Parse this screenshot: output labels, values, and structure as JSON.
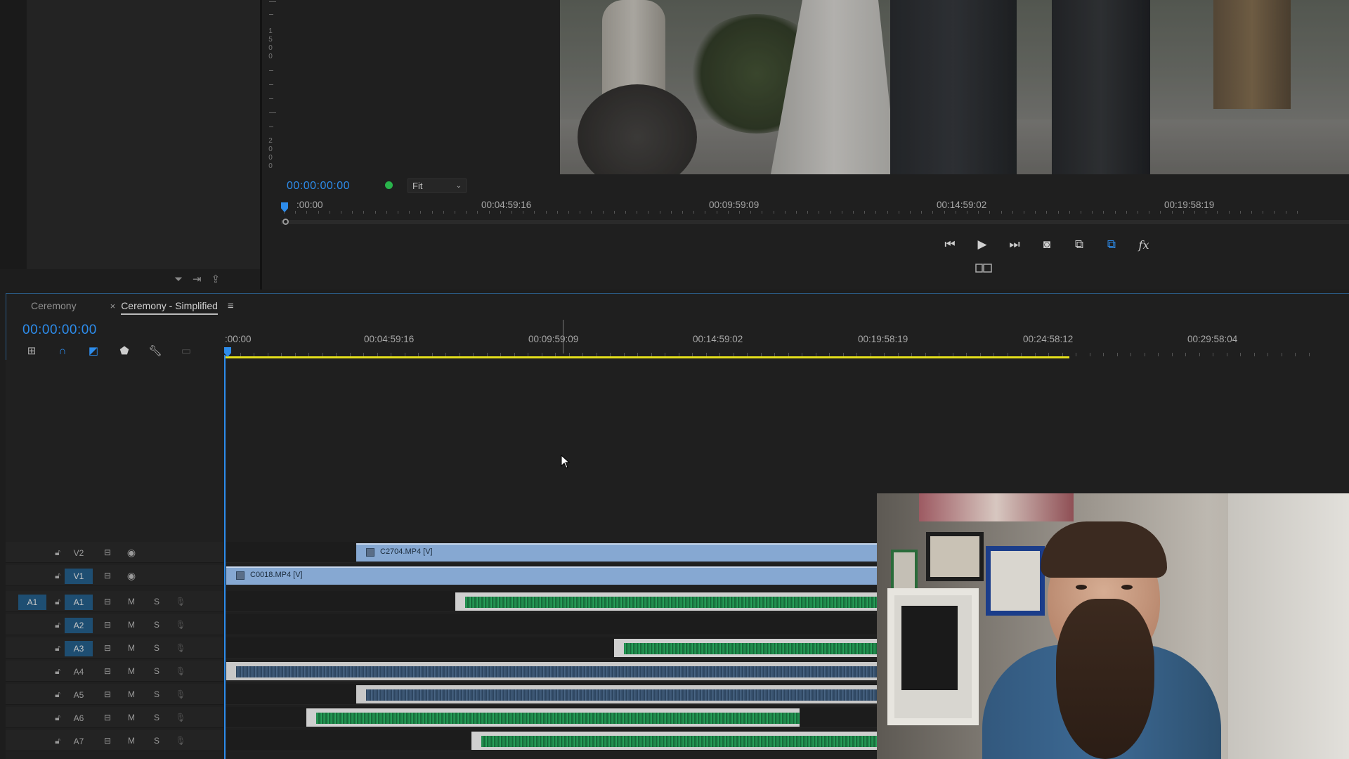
{
  "panel_tools": {
    "filter_icon": "filter-icon",
    "insert_icon": "insert-icon",
    "export_icon": "export-icon"
  },
  "monitor": {
    "timecode": "00:00:00:00",
    "fit_option": "Fit",
    "vruler_numbers": [
      "1",
      "5",
      "0",
      "0",
      "2",
      "0",
      "0",
      "0"
    ],
    "ruler_labels": [
      ":00:00",
      "00:04:59:16",
      "00:09:59:09",
      "00:14:59:02",
      "00:19:58:19"
    ],
    "transport": [
      "step-back-icon",
      "play-icon",
      "step-forward-icon",
      "export-frame-icon",
      "comparison-view-icon",
      "proxy-toggle-icon",
      "fx-icon"
    ],
    "fx_label": "fx"
  },
  "timeline": {
    "tabs": [
      {
        "label": "Ceremony"
      },
      {
        "label": "Ceremony - Simplified"
      }
    ],
    "close_glyph": "×",
    "menu_glyph": "≡",
    "timecode": "00:00:00:00",
    "ruler_labels": [
      ":00:00",
      "00:04:59:16",
      "00:09:59:09",
      "00:14:59:02",
      "00:19:58:19",
      "00:24:58:12",
      "00:29:58:04"
    ],
    "tools": [
      "nest-icon",
      "snap-icon",
      "linked-selection-icon",
      "marker-icon",
      "wrench-icon",
      "captions-icon"
    ],
    "source_patch": "A1",
    "video_tracks": [
      {
        "label": "V2",
        "clip_name": "C2704.MP4 [V]"
      },
      {
        "label": "V1",
        "clip_name": "C0018.MP4 [V]"
      }
    ],
    "audio_tracks": [
      {
        "label": "A1",
        "mute": "M",
        "solo": "S"
      },
      {
        "label": "A2",
        "mute": "M",
        "solo": "S"
      },
      {
        "label": "A3",
        "mute": "M",
        "solo": "S"
      },
      {
        "label": "A4",
        "mute": "M",
        "solo": "S"
      },
      {
        "label": "A5",
        "mute": "M",
        "solo": "S"
      },
      {
        "label": "A6",
        "mute": "M",
        "solo": "S"
      },
      {
        "label": "A7",
        "mute": "M",
        "solo": "S"
      }
    ]
  },
  "colors": {
    "accent": "#2d8ceb",
    "work_area": "#e5e01b",
    "video_clip": "#86a8d2",
    "audio_wave_green": "#1f8a4c",
    "audio_wave_blue": "#2e4660"
  }
}
